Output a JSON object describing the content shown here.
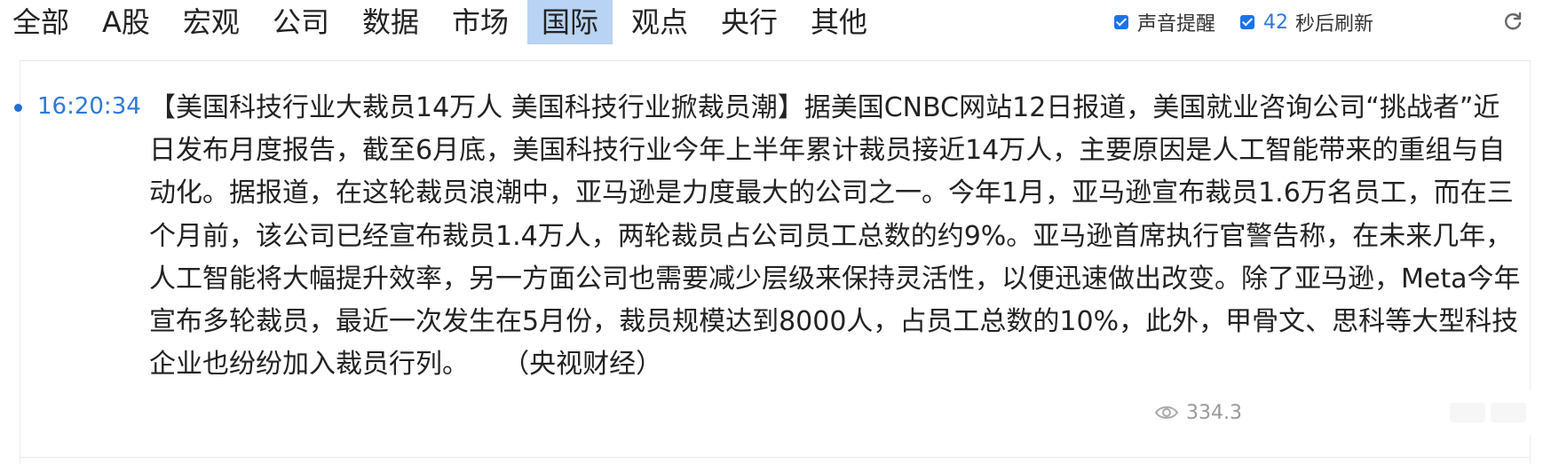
{
  "nav": {
    "tabs": [
      {
        "label": "全部"
      },
      {
        "label": "A股"
      },
      {
        "label": "宏观"
      },
      {
        "label": "公司"
      },
      {
        "label": "数据"
      },
      {
        "label": "市场"
      },
      {
        "label": "国际",
        "active": true
      },
      {
        "label": "观点"
      },
      {
        "label": "央行"
      },
      {
        "label": "其他"
      }
    ]
  },
  "controls": {
    "sound_alert_label": "声音提醒",
    "sound_alert_checked": true,
    "refresh_count": "42",
    "refresh_suffix": "秒后刷新",
    "auto_refresh_checked": true,
    "refresh_icon": "refresh-icon"
  },
  "news": {
    "time": "16:20:34",
    "title": "【美国科技行业大裁员14万人 美国科技行业掀裁员潮】",
    "body": "据美国CNBC网站12日报道，美国就业咨询公司“挑战者”近日发布月度报告，截至6月底，美国科技行业今年上半年累计裁员接近14万人，主要原因是人工智能带来的重组与自动化。据报道，在这轮裁员浪潮中，亚马逊是力度最大的公司之一。今年1月，亚马逊宣布裁员1.6万名员工，而在三个月前，该公司已经宣布裁员1.4万人，两轮裁员占公司员工总数的约9%。亚马逊首席执行官警告称，在未来几年，人工智能将大幅提升效率，另一方面公司也需要减少层级来保持灵活性，以便迅速做出改变。除了亚马逊，Meta今年宣布多轮裁员，最近一次发生在5月份，裁员规模达到8000人，占员工总数的10%，此外，甲骨文、思科等大型科技企业也纷纷加入裁员行列。",
    "source": "（央视财经）",
    "views": "334.3",
    "view_icon": "eye-icon"
  },
  "colors": {
    "accent": "#2d7ad8",
    "active_tab_bg": "#b8d3f3",
    "checkbox": "#1a73e8"
  }
}
